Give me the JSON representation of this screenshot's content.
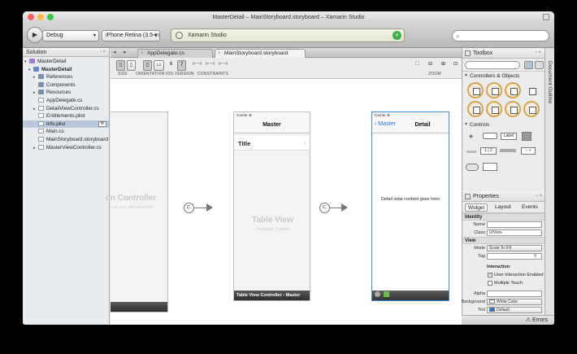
{
  "window": {
    "title": "MasterDetail – MainStoryboard.storyboard – Xamarin Studio"
  },
  "toolbar": {
    "config": "Debug",
    "device": "iPhone Retina (3.5-in",
    "status": "Xamarin Studio",
    "search_placeholder": ""
  },
  "solution": {
    "title": "Solution",
    "items": [
      {
        "label": "MasterDetail",
        "kind": "solution"
      },
      {
        "label": "MasterDetail",
        "kind": "project"
      },
      {
        "label": "References",
        "kind": "folder"
      },
      {
        "label": "Components",
        "kind": "folder"
      },
      {
        "label": "Resources",
        "kind": "folder"
      },
      {
        "label": "AppDelegate.cs",
        "kind": "file"
      },
      {
        "label": "DetailViewController.cs",
        "kind": "file"
      },
      {
        "label": "Entitlements.plist",
        "kind": "file"
      },
      {
        "label": "Info.plist",
        "kind": "file"
      },
      {
        "label": "Main.cs",
        "kind": "file"
      },
      {
        "label": "MainStoryboard.storyboard",
        "kind": "file"
      },
      {
        "label": "MasterViewController.cs",
        "kind": "file"
      }
    ]
  },
  "editor": {
    "tabs": [
      {
        "label": "AppDelegate.cs"
      },
      {
        "label": "MainStoryboard.storyboard"
      }
    ],
    "design_labels": {
      "size": "SIZE",
      "orientation": "ORIENTATION",
      "ios_version": "IOS VERSION",
      "constraints": "CONSTRAINTS",
      "zoom": "ZOOM",
      "ios6": "6",
      "ios7": "7"
    },
    "scenes": {
      "nav": {
        "title": "on Controller",
        "subtitle": "to set root view controller"
      },
      "master": {
        "carrier": "Carrier ⊗",
        "title": "Master",
        "row": "Title",
        "ghost": "Table View",
        "ghost_sub": "Prototype Content",
        "footer": "Table View Controller - Master"
      },
      "detail": {
        "carrier": "Carrier ⊗",
        "back": "Master",
        "title": "Detail",
        "content": "Detail view content goes here"
      }
    }
  },
  "toolbox": {
    "title": "Toolbox",
    "sections": {
      "controllers": "Controllers & Objects",
      "controls": "Controls"
    },
    "controls": {
      "label": "Label",
      "seg1": "1",
      "seg2": "2"
    }
  },
  "properties": {
    "title": "Properties",
    "tabs": {
      "widget": "Widget",
      "layout": "Layout",
      "events": "Events"
    },
    "groups": {
      "identity": "Identity",
      "view": "View",
      "interaction": "Interaction"
    },
    "fields": {
      "name_label": "Name",
      "name_value": "",
      "class_label": "Class",
      "class_value": "UIView",
      "mode_label": "Mode",
      "mode_value": "Scale To Fill",
      "tag_label": "Tag",
      "tag_value": "0",
      "user_interaction": "User Interaction Enabled",
      "multiple_touch": "Multiple Touch",
      "alpha_label": "Alpha",
      "alpha_value": "",
      "background_label": "Background",
      "background_value": "White Color",
      "tint_label": "Tint",
      "tint_value": "Default"
    }
  },
  "side": {
    "document_outline": "Document Outline"
  },
  "statusbar": {
    "errors": "Errors"
  }
}
